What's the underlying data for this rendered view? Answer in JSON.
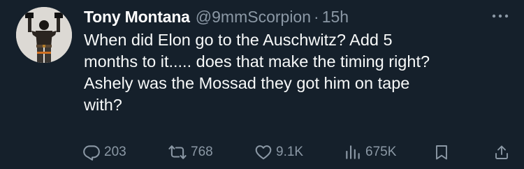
{
  "tweet": {
    "display_name": "Tony Montana",
    "handle": "@9mmScorpion",
    "separator": "·",
    "time": "15h",
    "text": "When did Elon go to the Auschwitz? Add 5\nmonths to it..... does that make the timing right?\nAshely was the Mossad they got him on tape\nwith?"
  },
  "actions": {
    "replies": "203",
    "reposts": "768",
    "likes": "9.1K",
    "views": "675K"
  },
  "icons": {
    "more": "more-icon",
    "reply": "reply-icon",
    "repost": "repost-icon",
    "like": "heart-icon",
    "views": "views-icon",
    "bookmark": "bookmark-icon",
    "share": "share-icon"
  },
  "colors": {
    "background": "#15202b",
    "primary_text": "#f7f9f9",
    "secondary_text": "#8b98a5"
  }
}
